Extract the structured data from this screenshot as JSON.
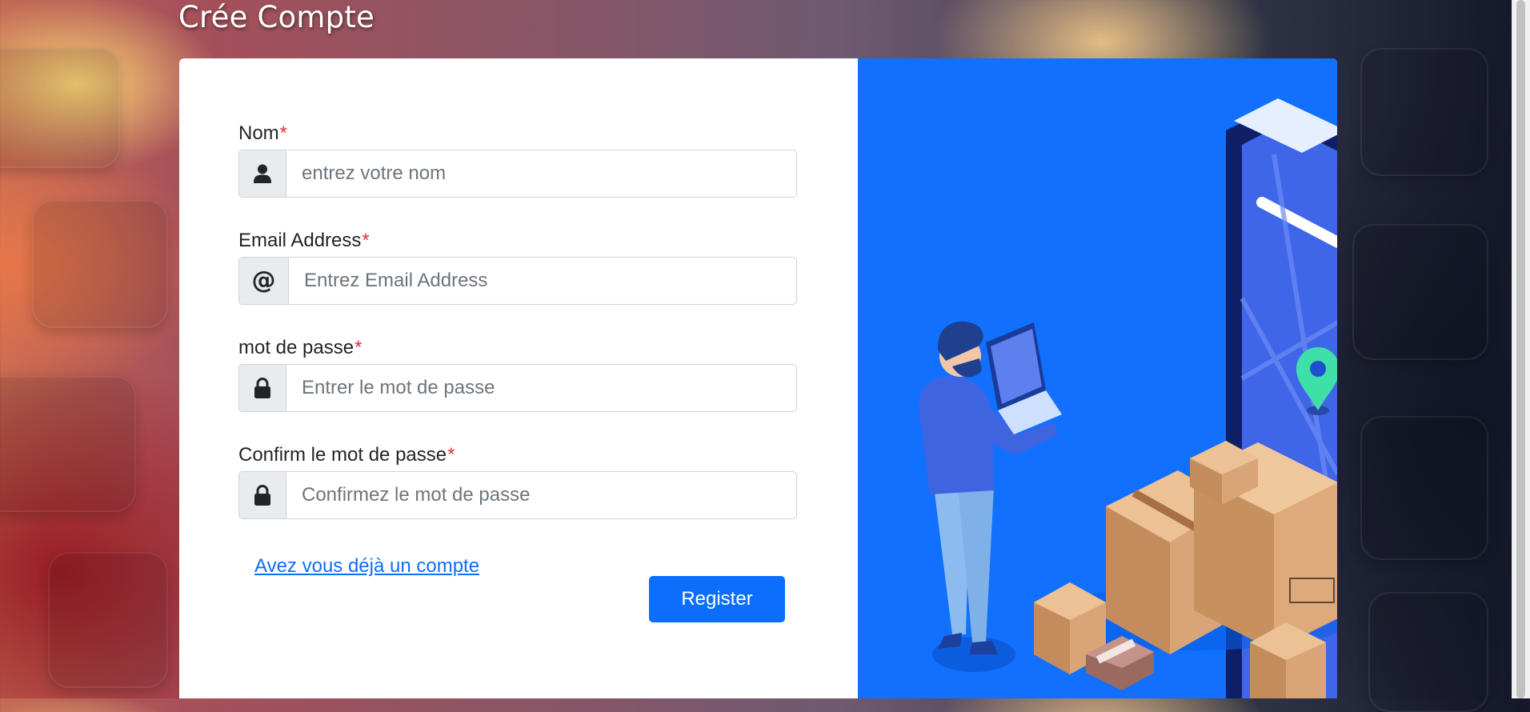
{
  "page": {
    "title": "Crée Compte"
  },
  "form": {
    "required_marker": "*",
    "fields": [
      {
        "label": "Nom",
        "placeholder": "entrez votre nom",
        "icon": "user-icon"
      },
      {
        "label": "Email Address",
        "placeholder": "Entrez Email Address",
        "icon": "at-sign-icon",
        "icon_glyph": "@"
      },
      {
        "label": "mot de passe",
        "placeholder": "Entrer le mot de passe",
        "icon": "lock-icon"
      },
      {
        "label": "Confirm le mot de passe",
        "placeholder": "Confirmez le mot de passe",
        "icon": "lock-icon"
      }
    ],
    "login_link": "Avez vous déjà un compte",
    "register_label": "Register"
  },
  "colors": {
    "primary": "#0d6efd",
    "required": "#dc3545",
    "illustration_bg": "#1170fd"
  }
}
